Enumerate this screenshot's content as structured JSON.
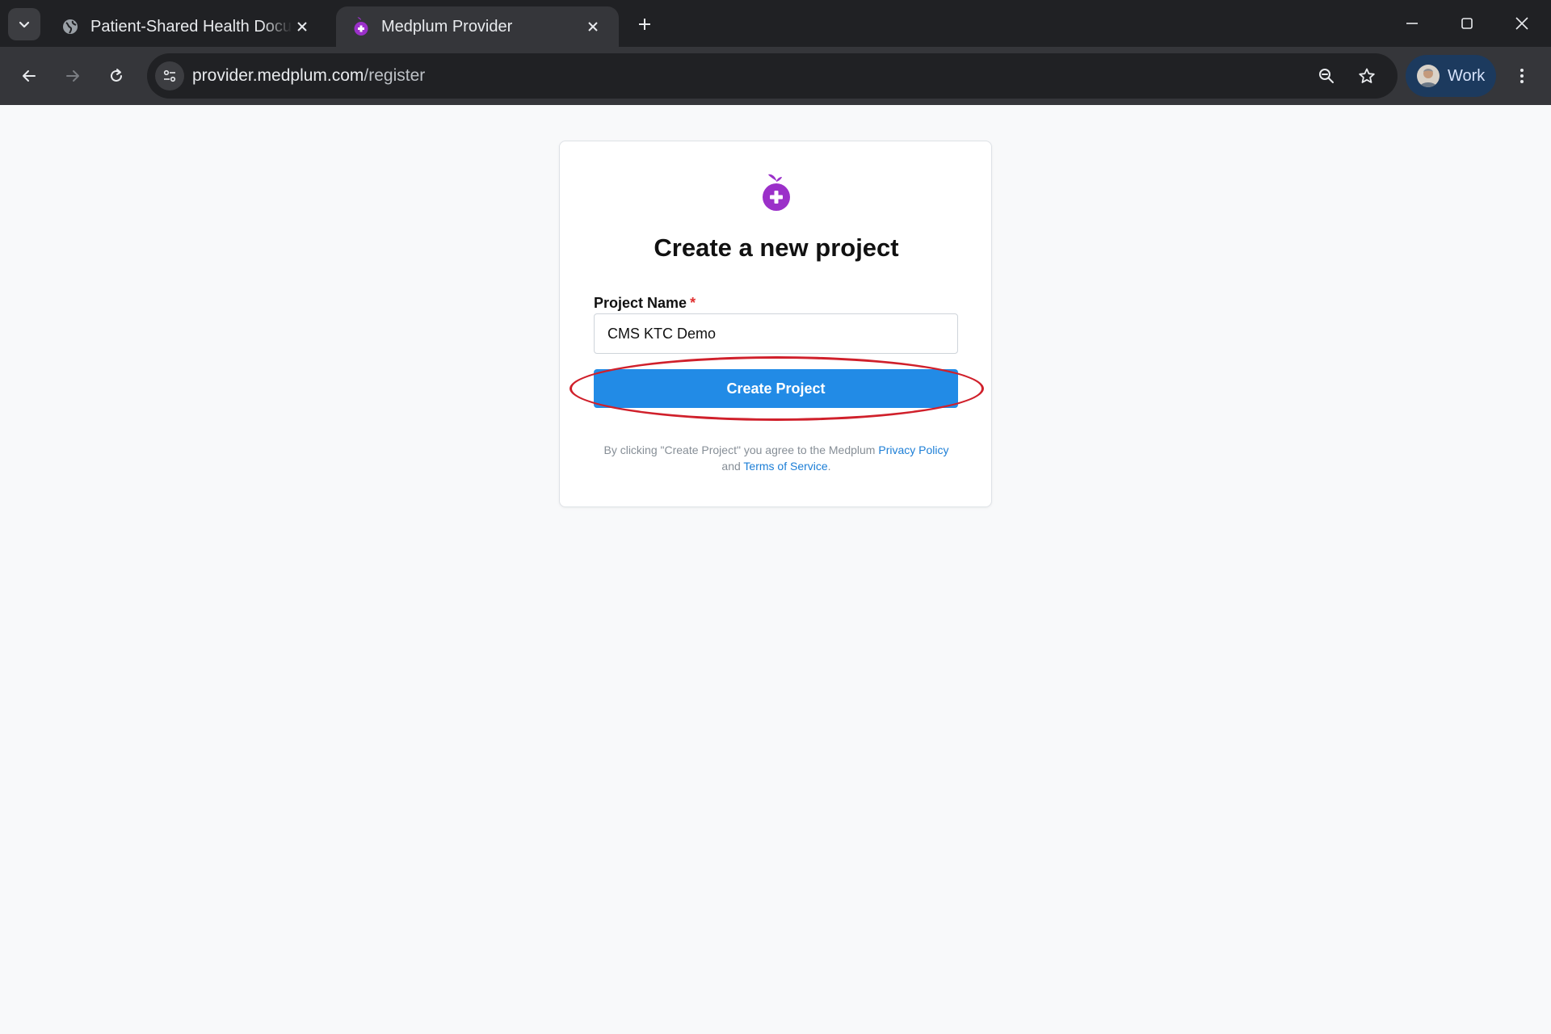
{
  "browser": {
    "tabs": [
      {
        "title": "Patient-Shared Health Documen",
        "icon": "globe-icon",
        "active": false
      },
      {
        "title": "Medplum Provider",
        "icon": "medplum-icon",
        "active": true
      }
    ],
    "address": {
      "host": "provider.medplum.com",
      "path": "/register"
    },
    "profile_label": "Work"
  },
  "card": {
    "heading": "Create a new project",
    "field_label": "Project Name",
    "required_marker": "*",
    "field_value": "CMS KTC Demo",
    "button_label": "Create Project",
    "legal": {
      "prefix": "By clicking \"Create Project\" you agree to the Medplum",
      "privacy_link": "Privacy Policy",
      "and": "and",
      "terms_link": "Terms of Service",
      "suffix": "."
    }
  },
  "colors": {
    "brand": "#9b30c9",
    "button": "#228be6",
    "highlight": "#d0202b",
    "link": "#1c7ed6"
  }
}
